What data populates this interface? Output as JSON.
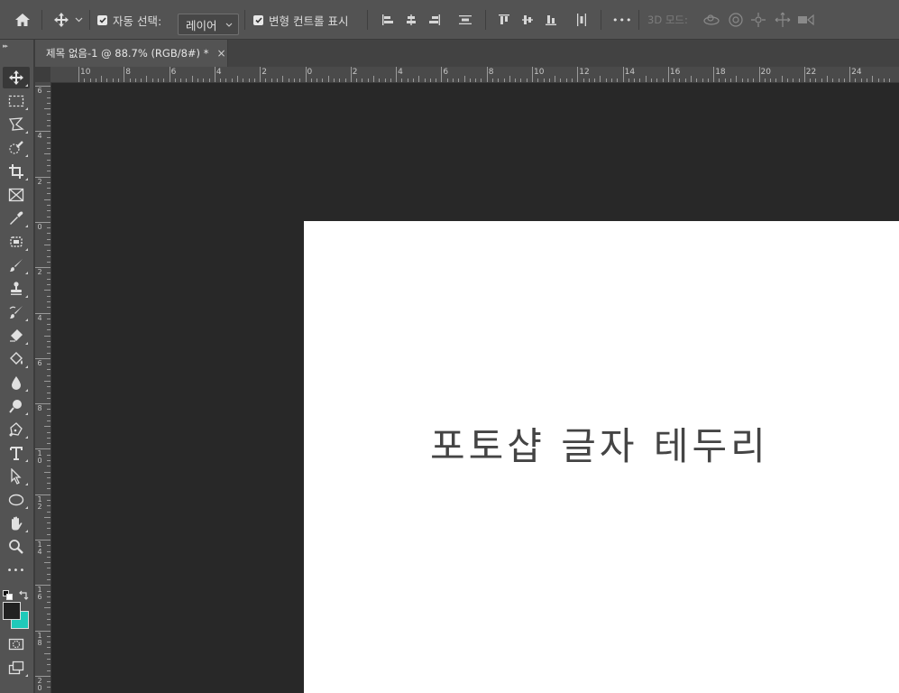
{
  "options": {
    "auto_select_label": "자동 선택:",
    "auto_select_value": "레이어",
    "show_transform_label": "변형 컨트롤 표시",
    "more_label": "•••",
    "mode_3d_label": "3D 모드:"
  },
  "document": {
    "tab_title": "제목 없음-1 @ 88.7% (RGB/8#) *",
    "close_glyph": "×",
    "canvas_text": "포토샵 글자 테두리"
  },
  "toolbar": {
    "more_label": "•••",
    "foreground_color": "#222222",
    "background_color": "#1fc9b9"
  },
  "ruler": {
    "top": [
      "10",
      "8",
      "6",
      "4",
      "2",
      "0",
      "2",
      "4",
      "6",
      "8",
      "10",
      "12",
      "14",
      "16",
      "18",
      "20",
      "22",
      "24"
    ],
    "left": [
      "6",
      "4",
      "2",
      "0",
      "2",
      "4",
      "6",
      "8",
      "10",
      "12",
      "14",
      "16",
      "18",
      "20"
    ]
  }
}
